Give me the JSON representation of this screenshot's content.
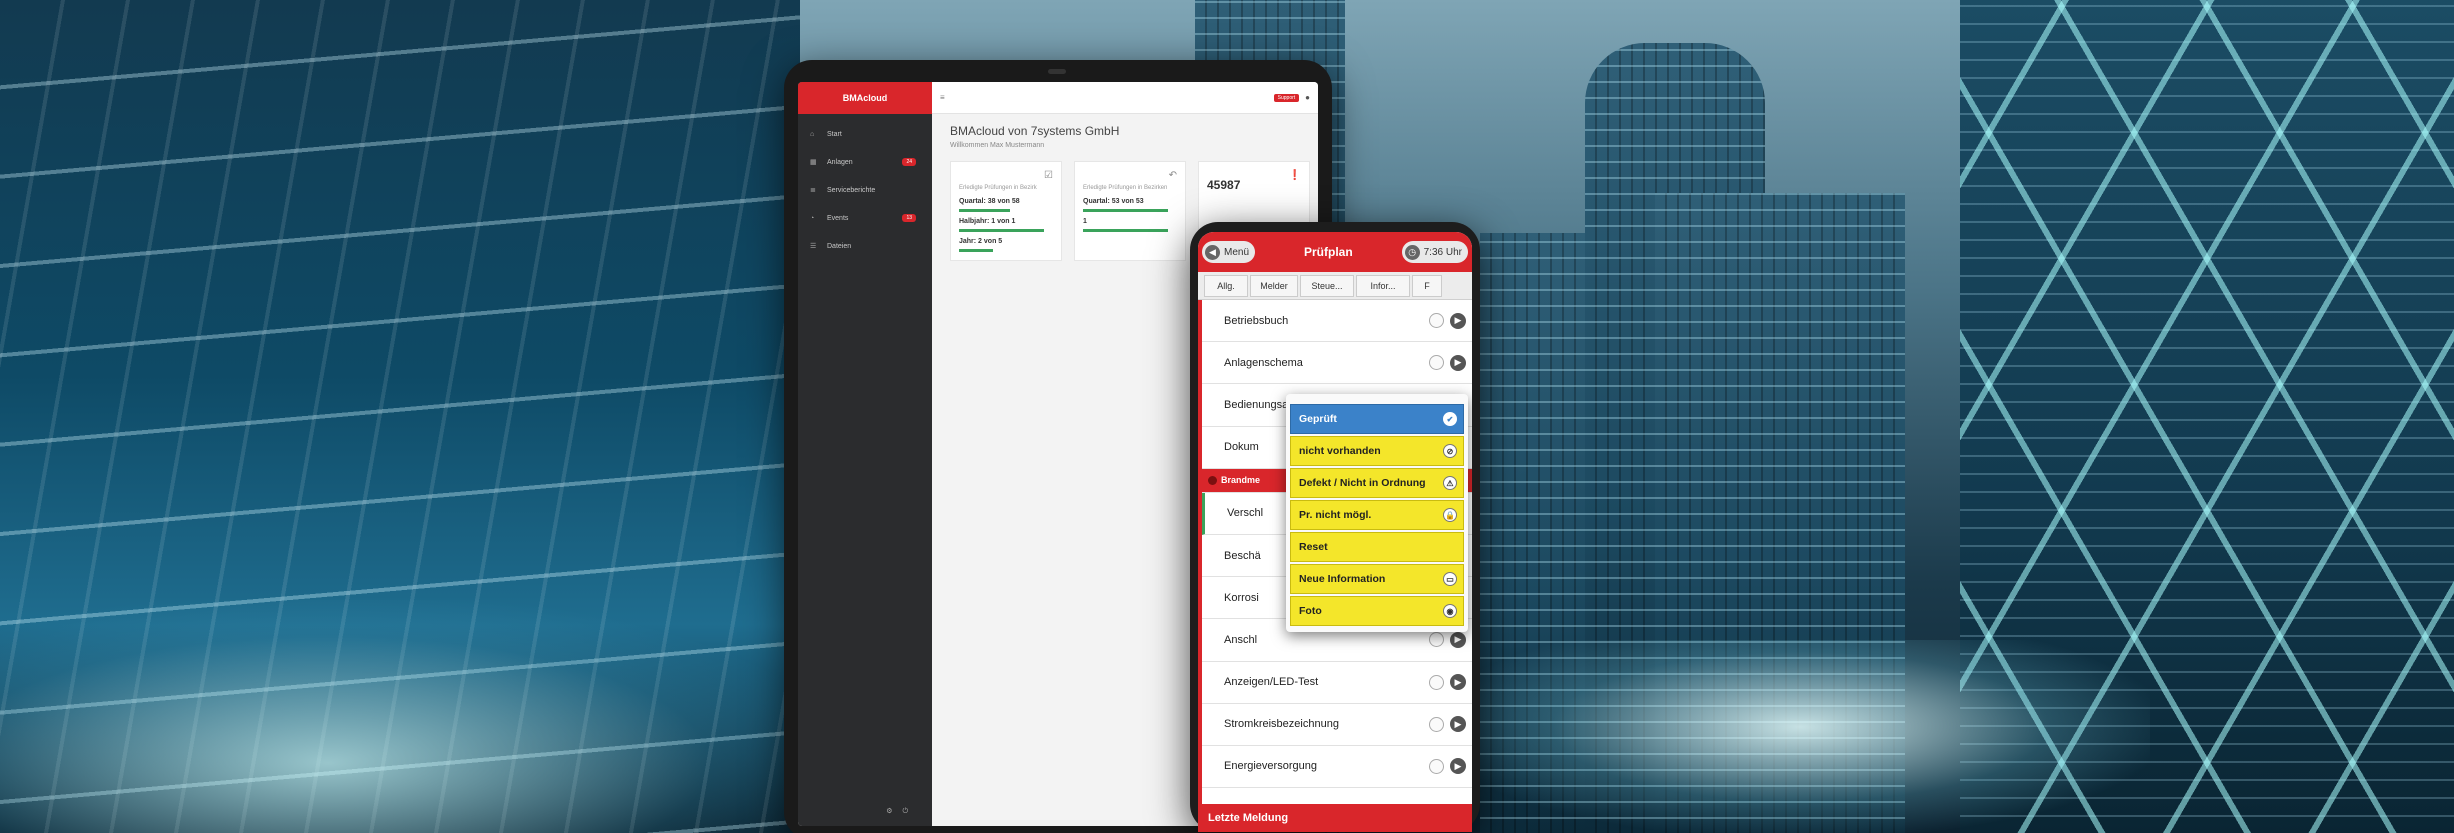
{
  "tablet": {
    "brand": "BMAcloud",
    "topbar": {
      "menu_icon": "≡",
      "support_label": "Support",
      "user_icon": "user-icon"
    },
    "nav": [
      {
        "label": "Start",
        "badge": ""
      },
      {
        "label": "Anlagen",
        "badge": "24"
      },
      {
        "label": "Serviceberichte",
        "badge": ""
      },
      {
        "label": "Events",
        "badge": "13"
      },
      {
        "label": "Dateien",
        "badge": ""
      }
    ],
    "title": "BMAcloud von 7systems GmbH",
    "subtitle": "Willkommen Max Mustermann",
    "cards": [
      {
        "label": "Erledigte Prüfungen in Bezirk",
        "rows": [
          "Quartal: 38 von 58",
          "Halbjahr: 1 von 1",
          "Jahr: 2 von 5"
        ]
      },
      {
        "label": "Erledigte Prüfungen in Bezirken",
        "rows": [
          "Quartal: 53 von 53",
          "1"
        ]
      },
      {
        "label": "",
        "big": "45987"
      }
    ]
  },
  "phone": {
    "menu_label": "Menü",
    "title": "Prüfplan",
    "time": "7:36 Uhr",
    "tabs": [
      "Allg.",
      "Melder",
      "Steue...",
      "Infor...",
      "F"
    ],
    "items": [
      "Betriebsbuch",
      "Anlagenschema",
      "Bedienungsanleitungen",
      "Dokum",
      "Brandme",
      "Verschl",
      "Beschä",
      "Korrosi",
      "Anschl",
      "Anzeigen/LED-Test",
      "Stromkreisbezeichnung",
      "Energieversorgung"
    ],
    "footer": "Letzte Meldung",
    "popup": [
      {
        "label": "Geprüft",
        "icon": "✔"
      },
      {
        "label": "nicht vorhanden",
        "icon": "⊘"
      },
      {
        "label": "Defekt / Nicht in Ordnung",
        "icon": "⚠"
      },
      {
        "label": "Pr. nicht mögl.",
        "icon": "🔒"
      },
      {
        "label": "Reset",
        "icon": ""
      },
      {
        "label": "Neue Information",
        "icon": "▭"
      },
      {
        "label": "Foto",
        "icon": "◉"
      }
    ]
  },
  "colors": {
    "accent": "#d9262b",
    "popup_yellow": "#f4e62a",
    "popup_selected": "#3b82c9",
    "progress": "#3aa35b"
  }
}
